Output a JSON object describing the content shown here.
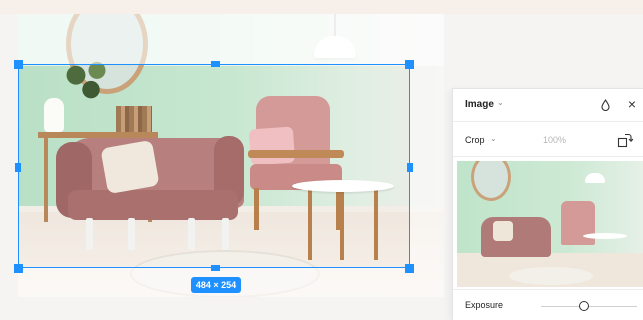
{
  "crop": {
    "dimensions": "484 × 254"
  },
  "panel": {
    "title": "Image",
    "title_chevron": "⌄",
    "close_glyph": "×",
    "crop_label": "Crop",
    "crop_chevron": "⌄",
    "zoom_value": "100%",
    "exposure_label": "Exposure",
    "exposure_level": 0.45
  },
  "colors": {
    "accent": "#1e90ff",
    "panel_bg": "#ffffff",
    "canvas_bg": "#f5f4f2"
  },
  "icons": {
    "title_dropdown": "chevron-down-icon",
    "drop": "drop-icon",
    "close": "close-icon",
    "crop_dropdown": "chevron-down-icon",
    "rotate": "rotate-crop-icon"
  }
}
